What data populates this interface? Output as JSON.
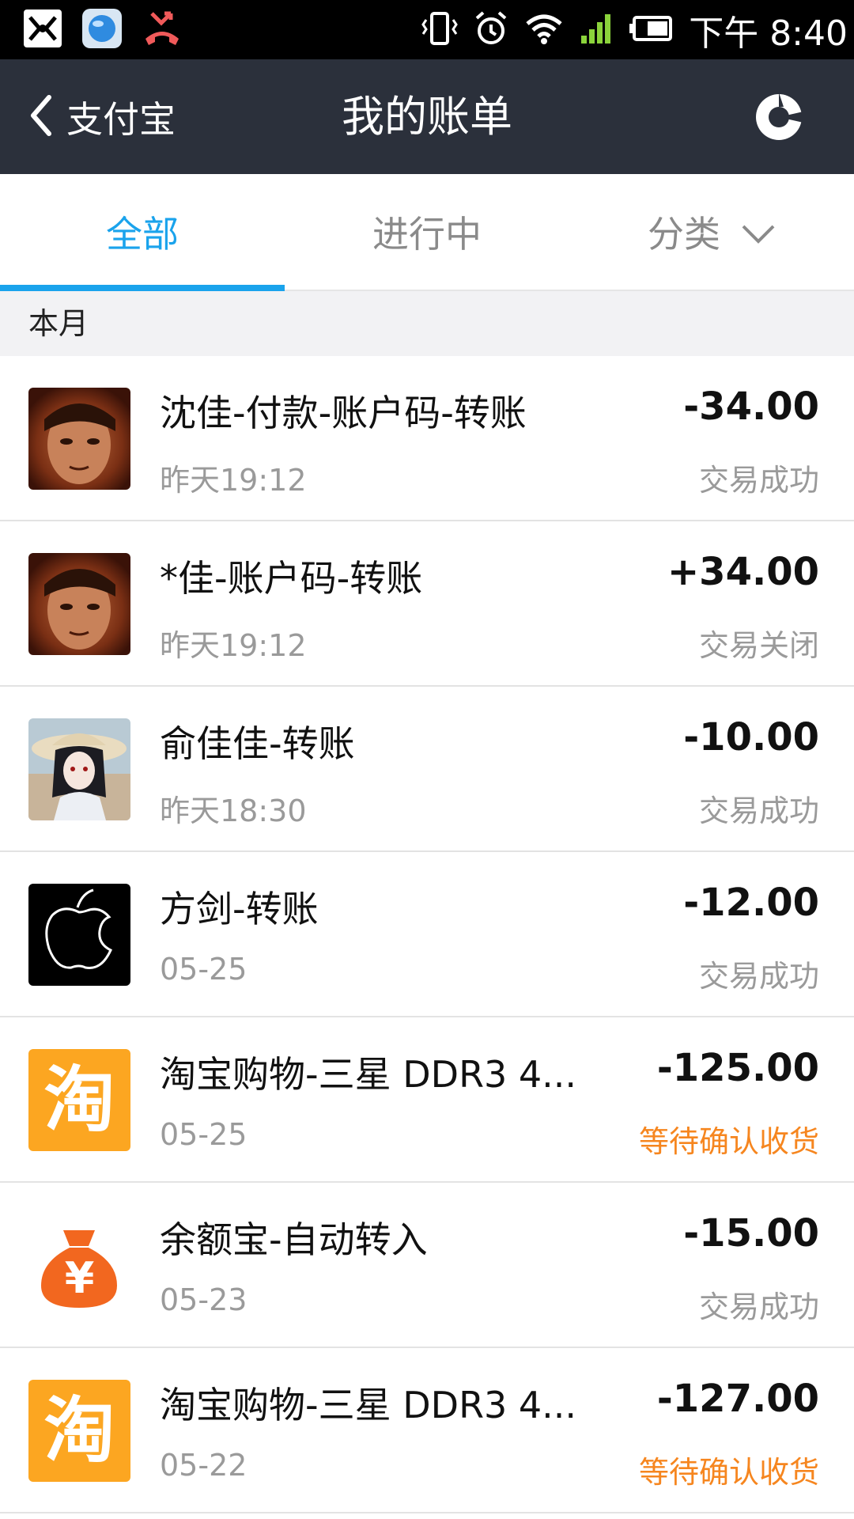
{
  "status_bar": {
    "time": "下午 8:40",
    "left_icons": [
      "app-notification-icon",
      "browser-notification-icon",
      "missed-call-icon"
    ],
    "right_icons": [
      "vibrate-icon",
      "alarm-icon",
      "wifi-icon",
      "signal-icon",
      "battery-icon"
    ]
  },
  "nav": {
    "back_label": "支付宝",
    "title": "我的账单",
    "right_icon": "pie-chart-icon"
  },
  "tabs": [
    {
      "label": "全部",
      "active": true
    },
    {
      "label": "进行中",
      "active": false
    },
    {
      "label": "分类",
      "active": false
    }
  ],
  "section": {
    "label": "本月"
  },
  "transactions": [
    {
      "title": "沈佳-付款-账户码-转账",
      "date": "昨天19:12",
      "amount": "-34.00",
      "status": "交易成功",
      "avatar": "person-photo"
    },
    {
      "title": "*佳-账户码-转账",
      "date": "昨天19:12",
      "amount": "+34.00",
      "status": "交易关闭",
      "avatar": "person-photo"
    },
    {
      "title": "俞佳佳-转账",
      "date": "昨天18:30",
      "amount": "-10.00",
      "status": "交易成功",
      "avatar": "anime-girl-photo"
    },
    {
      "title": "方剑-转账",
      "date": "05-25",
      "amount": "-12.00",
      "status": "交易成功",
      "avatar": "apple-sketch-logo"
    },
    {
      "title": "淘宝购物-三星 DDR3 4...",
      "date": "05-25",
      "amount": "-125.00",
      "status": "等待确认收货",
      "avatar": "taobao-logo",
      "avatar_text": "淘"
    },
    {
      "title": "余额宝-自动转入",
      "date": "05-23",
      "amount": "-15.00",
      "status": "交易成功",
      "avatar": "yuebao-money-bag-icon",
      "avatar_text": "¥"
    },
    {
      "title": "淘宝购物-三星 DDR3 4...",
      "date": "05-22",
      "amount": "-127.00",
      "status": "等待确认收货",
      "avatar": "taobao-logo",
      "avatar_text": "淘"
    }
  ],
  "colors": {
    "nav_bg": "#2b303b",
    "accent": "#1aa3ec",
    "pending": "#f6861f",
    "taobao": "#fca621",
    "yuebao": "#f2671f"
  }
}
